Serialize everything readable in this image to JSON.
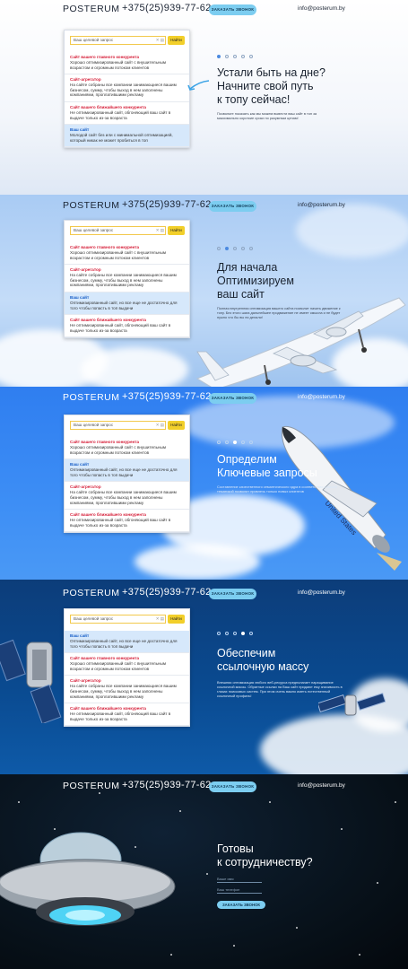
{
  "header": {
    "logo": "POSTERUM",
    "phone": "+375(25)939-77-62",
    "call_button": "ЗАКАЗАТЬ ЗВОНОК",
    "email": "info@posterum.by"
  },
  "search": {
    "placeholder": "Ваш целевой запрос",
    "button": "Найти"
  },
  "slides": [
    {
      "headline": [
        "Устали быть на дне?",
        "Начните свой путь",
        "к топу сейчас!"
      ],
      "sub": "Позвольте показать как мы можем вывести ваш сайт в топ за максимально короткие сроки по разумным ценам!",
      "results": [
        {
          "title": "Сайт вашего главного конкурента",
          "desc": "Хорошо оптимизированный сайт с внушительным возрастом и огромным потоком клиентов",
          "mine": false
        },
        {
          "title": "Сайт-агрегатор",
          "desc": "На сайте собраны все компании занимающиеся вашим бизнесом, сумму, чтобы выход в нем заполнены компаниями, проплатившими рекламу",
          "mine": false
        },
        {
          "title": "Сайт вашего ближайшего конкурента",
          "desc": "Не оптимизированный сайт, обгоняющий ваш сайт в выдаче только из-за возраста",
          "mine": false
        },
        {
          "title": "Ваш сайт",
          "desc": "Молодой сайт без или с минимальной оптимизацией, который никак не может пробиться в топ",
          "mine": true
        }
      ]
    },
    {
      "headline": [
        "Для начала",
        "Оптимизируем",
        "ваш сайт"
      ],
      "sub": "Полная внутренняя оптимизация вашего сайта позволит начать движение к топу. Без этого шага дальнейшее продвижение не имеет смысла и не будет нужно что бы вы ни делали!",
      "results": [
        {
          "title": "Сайт вашего главного конкурента",
          "desc": "Хорошо оптимизированный сайт с внушительным возрастом и огромным потоком клиентов",
          "mine": false
        },
        {
          "title": "Сайт-агрегатор",
          "desc": "На сайте собраны все компании занимающиеся вашим бизнесом, сумму, чтобы выход в нем заполнены компаниями, проплатившими рекламу",
          "mine": false
        },
        {
          "title": "Ваш сайт",
          "desc": "Оптимизированный сайт, но все еще не достаточно для того чтобы попасть в топ выдачи",
          "mine": true
        },
        {
          "title": "Сайт вашего ближайшего конкурента",
          "desc": "Не оптимизированный сайт, обгоняющий ваш сайт в выдаче только из-за возраста",
          "mine": false
        }
      ]
    },
    {
      "headline": [
        "Определим",
        "Ключевые запросы"
      ],
      "sub": "Составление качественного семантического ядра в соответствии с вашей тематикой позволит привлечь только новых клиентов",
      "results": [
        {
          "title": "Сайт вашего главного конкурента",
          "desc": "Хорошо оптимизированный сайт с внушительным возрастом и огромным потоком клиентов",
          "mine": false
        },
        {
          "title": "Ваш сайт",
          "desc": "Оптимизированный сайт, но все еще не достаточно для того чтобы попасть в топ выдачи",
          "mine": true
        },
        {
          "title": "Сайт-агрегатор",
          "desc": "На сайте собраны все компании занимающиеся вашим бизнесом, сумму, чтобы выход в нем заполнены компаниями, проплатившими рекламу",
          "mine": false
        },
        {
          "title": "Сайт вашего ближайшего конкурента",
          "desc": "Не оптимизированный сайт, обгоняющий ваш сайт в выдаче только из-за возраста",
          "mine": false
        }
      ]
    },
    {
      "headline": [
        "Обеспечим",
        "ссылочную массу"
      ],
      "sub": "Внешняя оптимизация любого веб-ресурса предполагает наращивание ссылочной массы. Обратные ссылки на Ваш сайт придают ему значимость в глазах поисковых систем. При этом очень важно иметь естественный ссылочный профиль!",
      "results": [
        {
          "title": "Ваш сайт",
          "desc": "Оптимизированный сайт, но все еще не достаточно для того чтобы попасть в топ выдачи",
          "mine": true
        },
        {
          "title": "Сайт вашего главного конкурента",
          "desc": "Хорошо оптимизированный сайт с внушительным возрастом и огромным потоком клиентов",
          "mine": false
        },
        {
          "title": "Сайт-агрегатор",
          "desc": "На сайте собраны все компании занимающиеся вашим бизнесом, сумму, чтобы выход в нем заполнены компаниями, проплатившими рекламу",
          "mine": false
        },
        {
          "title": "Сайт вашего ближайшего конкурента",
          "desc": "Не оптимизированный сайт, обгоняющий ваш сайт в выдаче только из-за возраста",
          "mine": false
        }
      ]
    }
  ],
  "cta": {
    "headline": [
      "Готовы",
      "к сотрудничеству?"
    ],
    "name_placeholder": "Ваше имя",
    "phone_placeholder": "Ваш телефон",
    "button": "ЗАКАЗАТЬ ЗВОНОК"
  },
  "colors": {
    "accent": "#7ccdf0",
    "link_red": "#d6203a",
    "link_blue": "#1960c8",
    "search_yellow": "#f2cf2a"
  },
  "icons": [
    "arrow-icon",
    "airplane-icon",
    "space-shuttle-icon",
    "satellite-icon",
    "ufo-icon"
  ]
}
